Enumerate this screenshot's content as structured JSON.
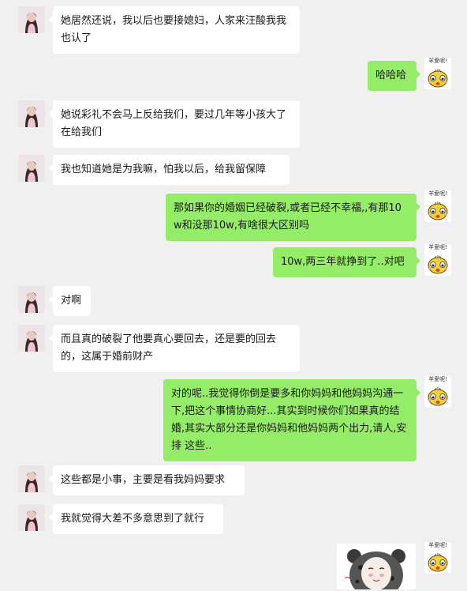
{
  "messages": [
    {
      "side": "left",
      "text": "她居然还说，我以后也要接媳妇，人家来汪酸我我也认了"
    },
    {
      "side": "right",
      "text": "哈哈哈"
    },
    {
      "side": "left",
      "text": "她说彩礼不会马上反给我们，要过几年等小孩大了在给我们"
    },
    {
      "side": "left",
      "text": "我也知道她是为我嘛，怕我以后，给我留保障"
    },
    {
      "side": "right",
      "text": "那如果你的婚姻已经破裂,或者已经不幸福,,有那10w和没那10w,有啥很大区别吗"
    },
    {
      "side": "right",
      "text": "10w,两三年就挣到了..对吧"
    },
    {
      "side": "left",
      "text": "对啊"
    },
    {
      "side": "left",
      "text": "而且真的破裂了他要真心要回去，还是要的回去的，这属于婚前财产"
    },
    {
      "side": "right",
      "text": "对的呢..我觉得你倒是要多和你妈妈和他妈妈沟通一下,把这个事情协商好...其实到时候你们如果真的结婚,其实大部分还是你妈妈和他妈妈两个出力,请人,安排 这些.."
    },
    {
      "side": "left",
      "text": "这些都是小事，主要是看我妈妈要求"
    },
    {
      "side": "left",
      "text": "我就觉得大差不多意思到了就行"
    },
    {
      "side": "right",
      "type": "sticker"
    }
  ],
  "self_avatar": {
    "caption": "羊爱呢!",
    "icon": "cartoon-face-icon"
  },
  "contact_avatar": {
    "icon": "woman-photo-icon"
  }
}
